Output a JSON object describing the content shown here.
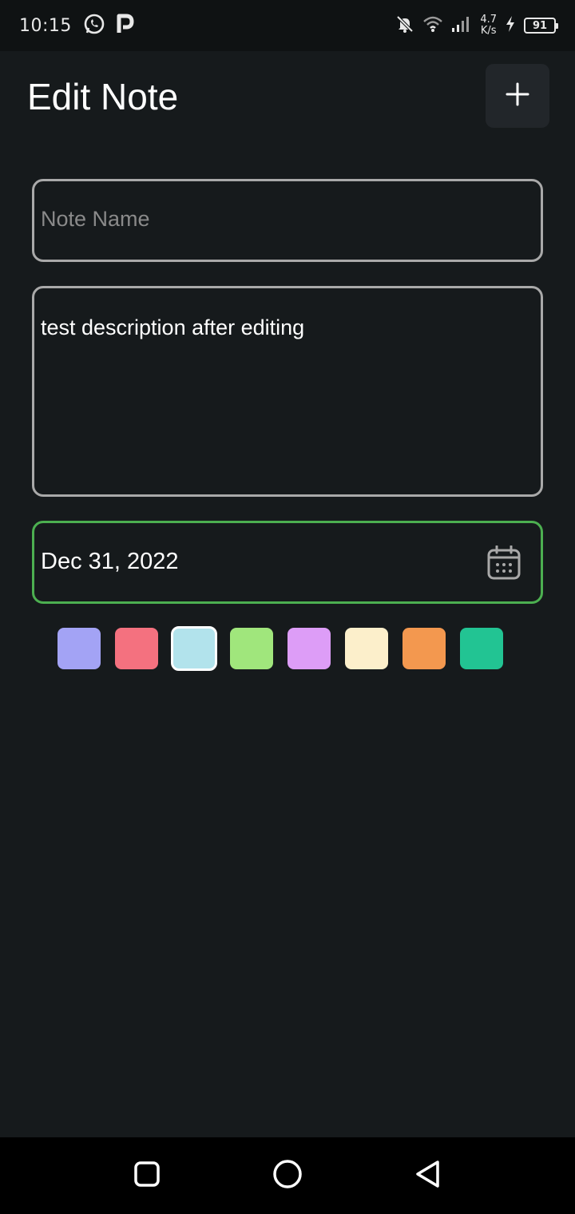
{
  "status_bar": {
    "time": "10:15",
    "speed_value": "4.7",
    "speed_unit": "K/s",
    "battery": "91",
    "icons": [
      "whatsapp-icon",
      "p-app-icon",
      "bell-muted-icon",
      "wifi-icon",
      "signal-icon",
      "charging-icon",
      "battery-icon"
    ]
  },
  "header": {
    "title": "Edit Note",
    "add_button_icon": "plus-icon"
  },
  "form": {
    "name_placeholder": "Note Name",
    "name_value": "",
    "description": "test description after editing",
    "date": "Dec 31, 2022",
    "date_icon": "calendar-icon"
  },
  "colors": {
    "swatches": [
      "#a3a3f5",
      "#f4717f",
      "#b2e3ec",
      "#a0e67c",
      "#dd9df7",
      "#fcefcb",
      "#f3984f",
      "#22c493"
    ],
    "selected_index": 2,
    "date_focus_border": "#4caf50"
  },
  "nav": {
    "icons": [
      "recents-icon",
      "home-icon",
      "back-icon"
    ]
  }
}
